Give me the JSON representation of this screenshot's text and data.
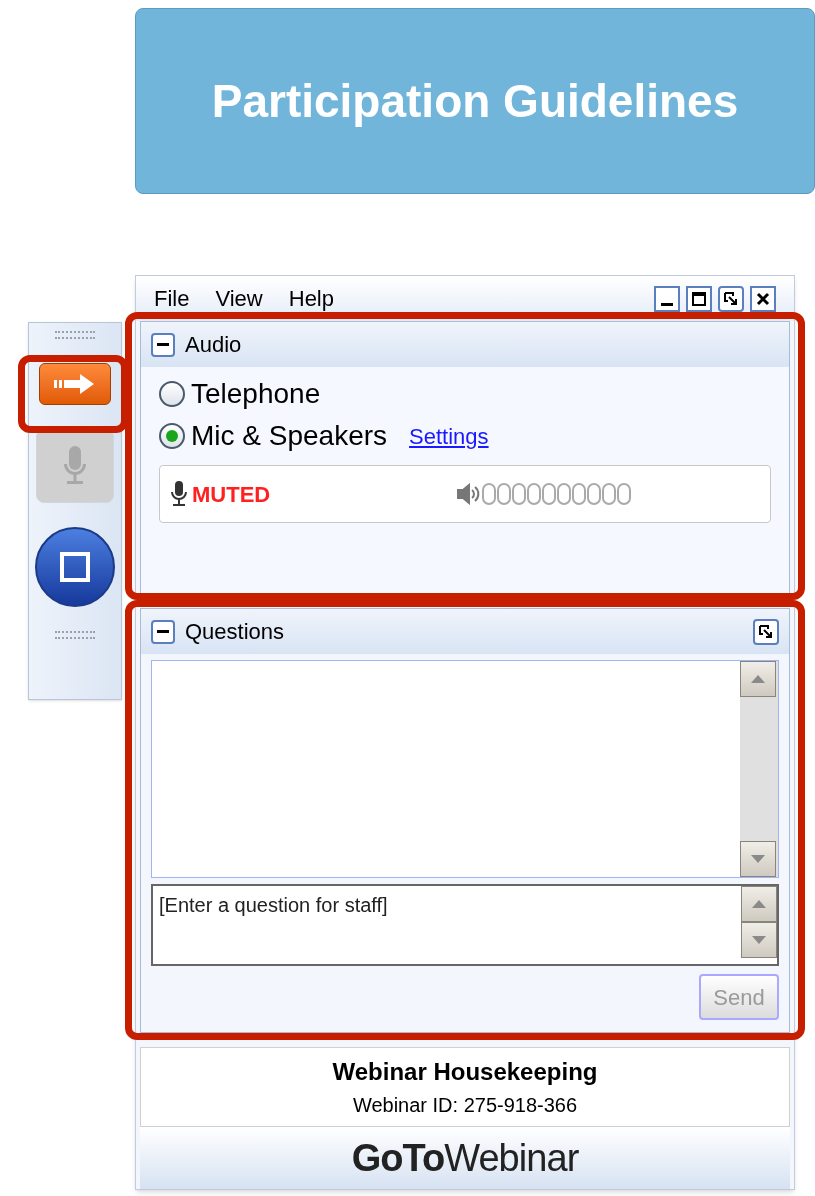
{
  "slide_title": "Participation Guidelines",
  "toolbar": {
    "buttons": [
      {
        "kind": "arrow",
        "disabled": false
      },
      {
        "kind": "mic",
        "disabled": true
      },
      {
        "kind": "screen",
        "disabled": false
      }
    ]
  },
  "menu": [
    "File",
    "View",
    "Help"
  ],
  "audio": {
    "title": "Audio",
    "options": [
      {
        "label": "Telephone",
        "selected": false
      },
      {
        "label": "Mic & Speakers",
        "selected": true
      }
    ],
    "settings_link": "Settings",
    "mic_status": "MUTED"
  },
  "questions": {
    "title": "Questions",
    "placeholder": "[Enter a question for staff]",
    "send_button": {
      "label": "Send",
      "disabled": true
    }
  },
  "footer": {
    "title": "Webinar Housekeeping",
    "webinar_id": "Webinar ID: 275-918-366",
    "logo": "**GoTo**Webinar"
  },
  "highlights": [
    {
      "kind": "button"
    },
    {
      "kind": "audio"
    },
    {
      "kind": "questions"
    }
  ]
}
